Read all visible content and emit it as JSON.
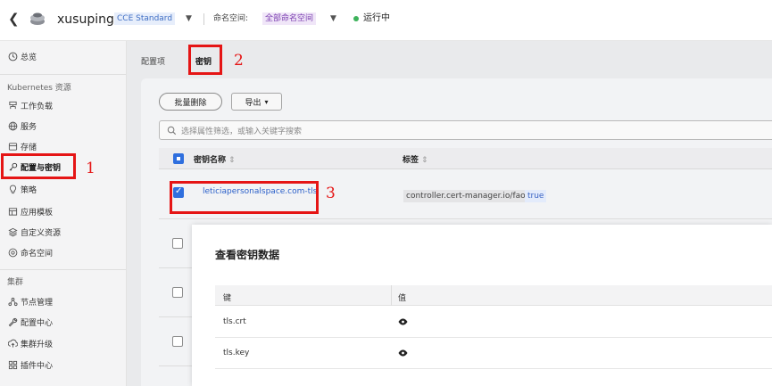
{
  "header": {
    "back_icon": "chevron-left-icon",
    "cluster_icon": "cluster-icon",
    "cluster_name": "xusuping",
    "edition": "CCE Standard",
    "namespace_label": "命名空间:",
    "namespace_value": "全部命名空间",
    "status": "运行中",
    "status_color": "#3db25b"
  },
  "sidebar": {
    "overview": "总览",
    "section_k8s": "Kubernetes 资源",
    "items": [
      {
        "label": "工作负载",
        "icon": "workload-icon"
      },
      {
        "label": "服务",
        "icon": "globe-icon"
      },
      {
        "label": "存储",
        "icon": "storage-icon"
      },
      {
        "label": "配置与密钥",
        "icon": "key-icon"
      },
      {
        "label": "策略",
        "icon": "bulb-icon"
      },
      {
        "label": "应用模板",
        "icon": "template-icon"
      },
      {
        "label": "自定义资源",
        "icon": "layers-icon"
      },
      {
        "label": "命名空间",
        "icon": "namespace-icon"
      }
    ],
    "section_cluster": "集群",
    "cluster_items": [
      {
        "label": "节点管理",
        "icon": "nodes-icon"
      },
      {
        "label": "配置中心",
        "icon": "wrench-icon"
      },
      {
        "label": "集群升级",
        "icon": "upgrade-icon"
      },
      {
        "label": "插件中心",
        "icon": "grid-icon"
      }
    ]
  },
  "tabs": [
    "配置项",
    "密钥"
  ],
  "toolbar": {
    "batch_delete": "批量删除",
    "export": "导出",
    "export_caret": "▾"
  },
  "search": {
    "placeholder": "选择属性筛选，或输入关键字搜索"
  },
  "table": {
    "col_name": "密钥名称",
    "col_labels": "标签",
    "sort_glyph": "⇕",
    "rows": [
      {
        "name": "leticiapersonalspace.com-tls",
        "label_key": "controller.cert-manager.io/fao",
        "label_value": "true",
        "checked": true
      }
    ]
  },
  "modal": {
    "title": "查看密钥数据",
    "col_key": "键",
    "col_value": "值",
    "rows": [
      {
        "key": "tls.crt",
        "icon": "eye-icon"
      },
      {
        "key": "tls.key",
        "icon": "eye-icon"
      }
    ]
  },
  "annotations": {
    "color": "#e51515",
    "marks": [
      "1",
      "2",
      "3"
    ]
  }
}
